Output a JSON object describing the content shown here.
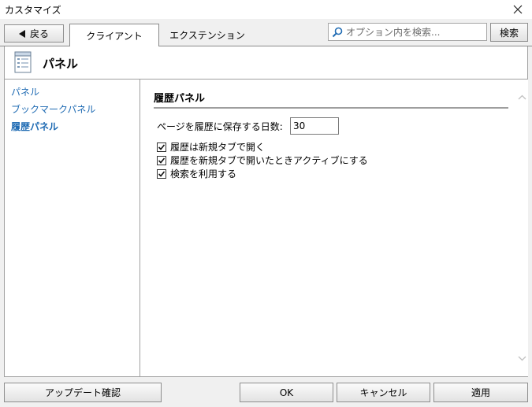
{
  "window": {
    "title": "カスタマイズ"
  },
  "toolbar": {
    "back_label": "戻る",
    "tabs": [
      {
        "label": "クライアント",
        "active": true
      },
      {
        "label": "エクステンション",
        "active": false
      }
    ],
    "search_placeholder": "オプション内を検索...",
    "search_button": "検索"
  },
  "header": {
    "title": "パネル"
  },
  "sidebar": {
    "items": [
      {
        "label": "パネル",
        "active": false
      },
      {
        "label": "ブックマークパネル",
        "active": false
      },
      {
        "label": "履歴パネル",
        "active": true
      }
    ]
  },
  "content": {
    "section_title": "履歴パネル",
    "days_label": "ページを履歴に保存する日数:",
    "days_value": "30",
    "checkboxes": [
      {
        "label": "履歴は新規タブで開く",
        "checked": true
      },
      {
        "label": "履歴を新規タブで開いたときアクティブにする",
        "checked": true
      },
      {
        "label": "検索を利用する",
        "checked": true
      }
    ]
  },
  "footer": {
    "update_button": "アップデート確認",
    "ok_button": "OK",
    "cancel_button": "キャンセル",
    "apply_button": "適用"
  },
  "colors": {
    "link": "#1f6bb3",
    "border": "#a0a0a0"
  }
}
